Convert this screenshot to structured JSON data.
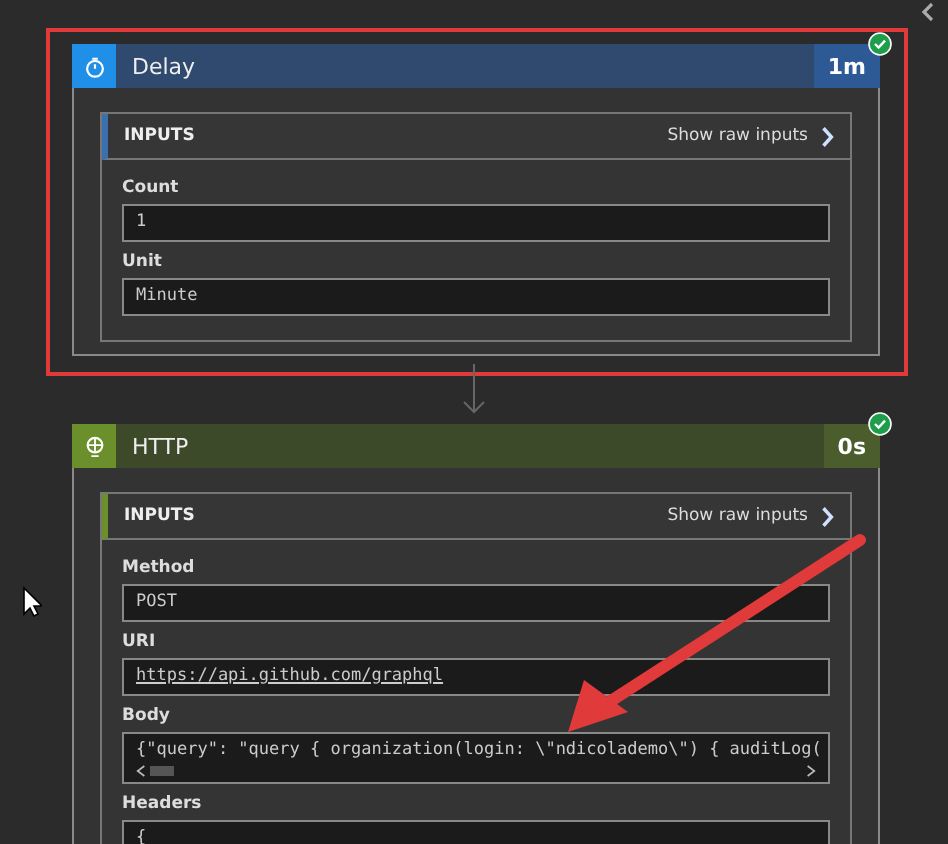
{
  "steps": [
    {
      "kind": "delay",
      "title": "Delay",
      "duration": "1m",
      "succeeded": true,
      "highlighted": true,
      "inputs_label": "INPUTS",
      "raw_link": "Show raw inputs",
      "fields": [
        {
          "kind": "text",
          "label": "Count",
          "value": "1"
        },
        {
          "kind": "text",
          "label": "Unit",
          "value": "Minute"
        }
      ]
    },
    {
      "kind": "http",
      "title": "HTTP",
      "duration": "0s",
      "succeeded": true,
      "highlighted": false,
      "inputs_label": "INPUTS",
      "raw_link": "Show raw inputs",
      "fields": [
        {
          "kind": "text",
          "label": "Method",
          "value": "POST"
        },
        {
          "kind": "link",
          "label": "URI",
          "value": "https://api.github.com/graphql"
        },
        {
          "kind": "scroll",
          "label": "Body",
          "value": "{\"query\": \"query { organization(login: \\\"ndicolademo\\\") { auditLog("
        },
        {
          "kind": "text",
          "label": "Headers",
          "value": "{"
        }
      ]
    }
  ]
}
